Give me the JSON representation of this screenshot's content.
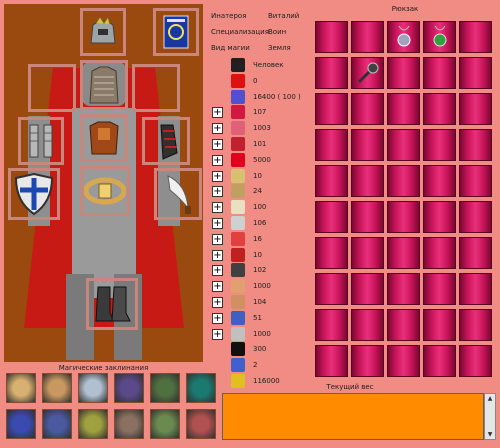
{
  "player": {
    "creator_label": "Инатероя",
    "creator_value": "Виталий",
    "spec_label": "Специализация",
    "spec_value": "Воин",
    "magic_label": "Вид магии",
    "magic_value": "Земля"
  },
  "spells_title": "Магические заклинания",
  "backpack_title": "Рюкзак",
  "weight_title": "Текущий вес",
  "stats": [
    {
      "plus": false,
      "value": "Человек",
      "icon": "yin-yang-icon",
      "color": "#202020"
    },
    {
      "plus": false,
      "value": "0",
      "icon": "red-arrow-icon",
      "color": "#e01010"
    },
    {
      "plus": false,
      "value": "16400   ( 100 )",
      "icon": "infinity-icon",
      "color": "#5050d0"
    },
    {
      "plus": true,
      "value": "107",
      "icon": "lips-icon",
      "color": "#d01840"
    },
    {
      "plus": true,
      "value": "1003",
      "icon": "brain-icon",
      "color": "#e0607a"
    },
    {
      "plus": true,
      "value": "101",
      "icon": "mouth-icon",
      "color": "#c02030"
    },
    {
      "plus": true,
      "value": "5000",
      "icon": "heart-icon",
      "color": "#e00020"
    },
    {
      "plus": true,
      "value": "10",
      "icon": "scroll-icon",
      "color": "#d8c070"
    },
    {
      "plus": true,
      "value": "24",
      "icon": "map-icon",
      "color": "#c0a060"
    },
    {
      "plus": true,
      "value": "100",
      "icon": "book-icon",
      "color": "#e8e0c0"
    },
    {
      "plus": true,
      "value": "106",
      "icon": "page-icon",
      "color": "#d0d0d0"
    },
    {
      "plus": true,
      "value": "16",
      "icon": "arrows-icon",
      "color": "#e04040"
    },
    {
      "plus": true,
      "value": "10",
      "icon": "arrow-up-icon",
      "color": "#c02020"
    },
    {
      "plus": true,
      "value": "102",
      "icon": "anvil-icon",
      "color": "#404040"
    },
    {
      "plus": true,
      "value": "1000",
      "icon": "hand-icon",
      "color": "#e0a070"
    },
    {
      "plus": true,
      "value": "104",
      "icon": "fist-icon",
      "color": "#d09060"
    },
    {
      "plus": true,
      "value": "51",
      "icon": "figure-icon",
      "color": "#4060c0"
    },
    {
      "plus": true,
      "value": "1000",
      "icon": "bones-icon",
      "color": "#c0c0c0"
    },
    {
      "plus": false,
      "value": "300",
      "icon": "cross-icon",
      "color": "#101010"
    },
    {
      "plus": false,
      "value": "2",
      "icon": "orb-icon",
      "color": "#4060d0"
    },
    {
      "plus": false,
      "value": "116000",
      "icon": "coin-icon",
      "color": "#e0c020"
    }
  ],
  "backpack_items": [
    {
      "row": 0,
      "col": 2,
      "icon": "amulet-icon"
    },
    {
      "row": 0,
      "col": 3,
      "icon": "green-amulet-icon"
    },
    {
      "row": 1,
      "col": 1,
      "icon": "mace-icon"
    }
  ],
  "equipment": [
    {
      "name": "helmet-slot",
      "icon": "helmet-icon"
    },
    {
      "name": "spellbook-slot",
      "icon": "spellbook-icon"
    },
    {
      "name": "neck-slot",
      "icon": "empty"
    },
    {
      "name": "armor-slot",
      "icon": "chainmail-icon"
    },
    {
      "name": "ring-slot",
      "icon": "empty"
    },
    {
      "name": "left-gauntlet-slot",
      "icon": "gauntlet-icon"
    },
    {
      "name": "cuirass-slot",
      "icon": "cuirass-icon"
    },
    {
      "name": "right-gauntlet-slot",
      "icon": "bracer-icon"
    },
    {
      "name": "shield-slot",
      "icon": "shield-icon"
    },
    {
      "name": "belt-slot",
      "icon": "belt-icon"
    },
    {
      "name": "weapon-slot",
      "icon": "scimitar-icon"
    },
    {
      "name": "boots-slot",
      "icon": "boots-icon"
    }
  ],
  "spells": [
    "rune-icon",
    "rune-icon",
    "amulet-icon",
    "cross-icon",
    "skull-icon",
    "ring-icon",
    "blue-sigil-icon",
    "blue-sigil-icon",
    "yellow-sigil-icon",
    "dragon-icon",
    "goblin-icon",
    "monster-icon"
  ]
}
